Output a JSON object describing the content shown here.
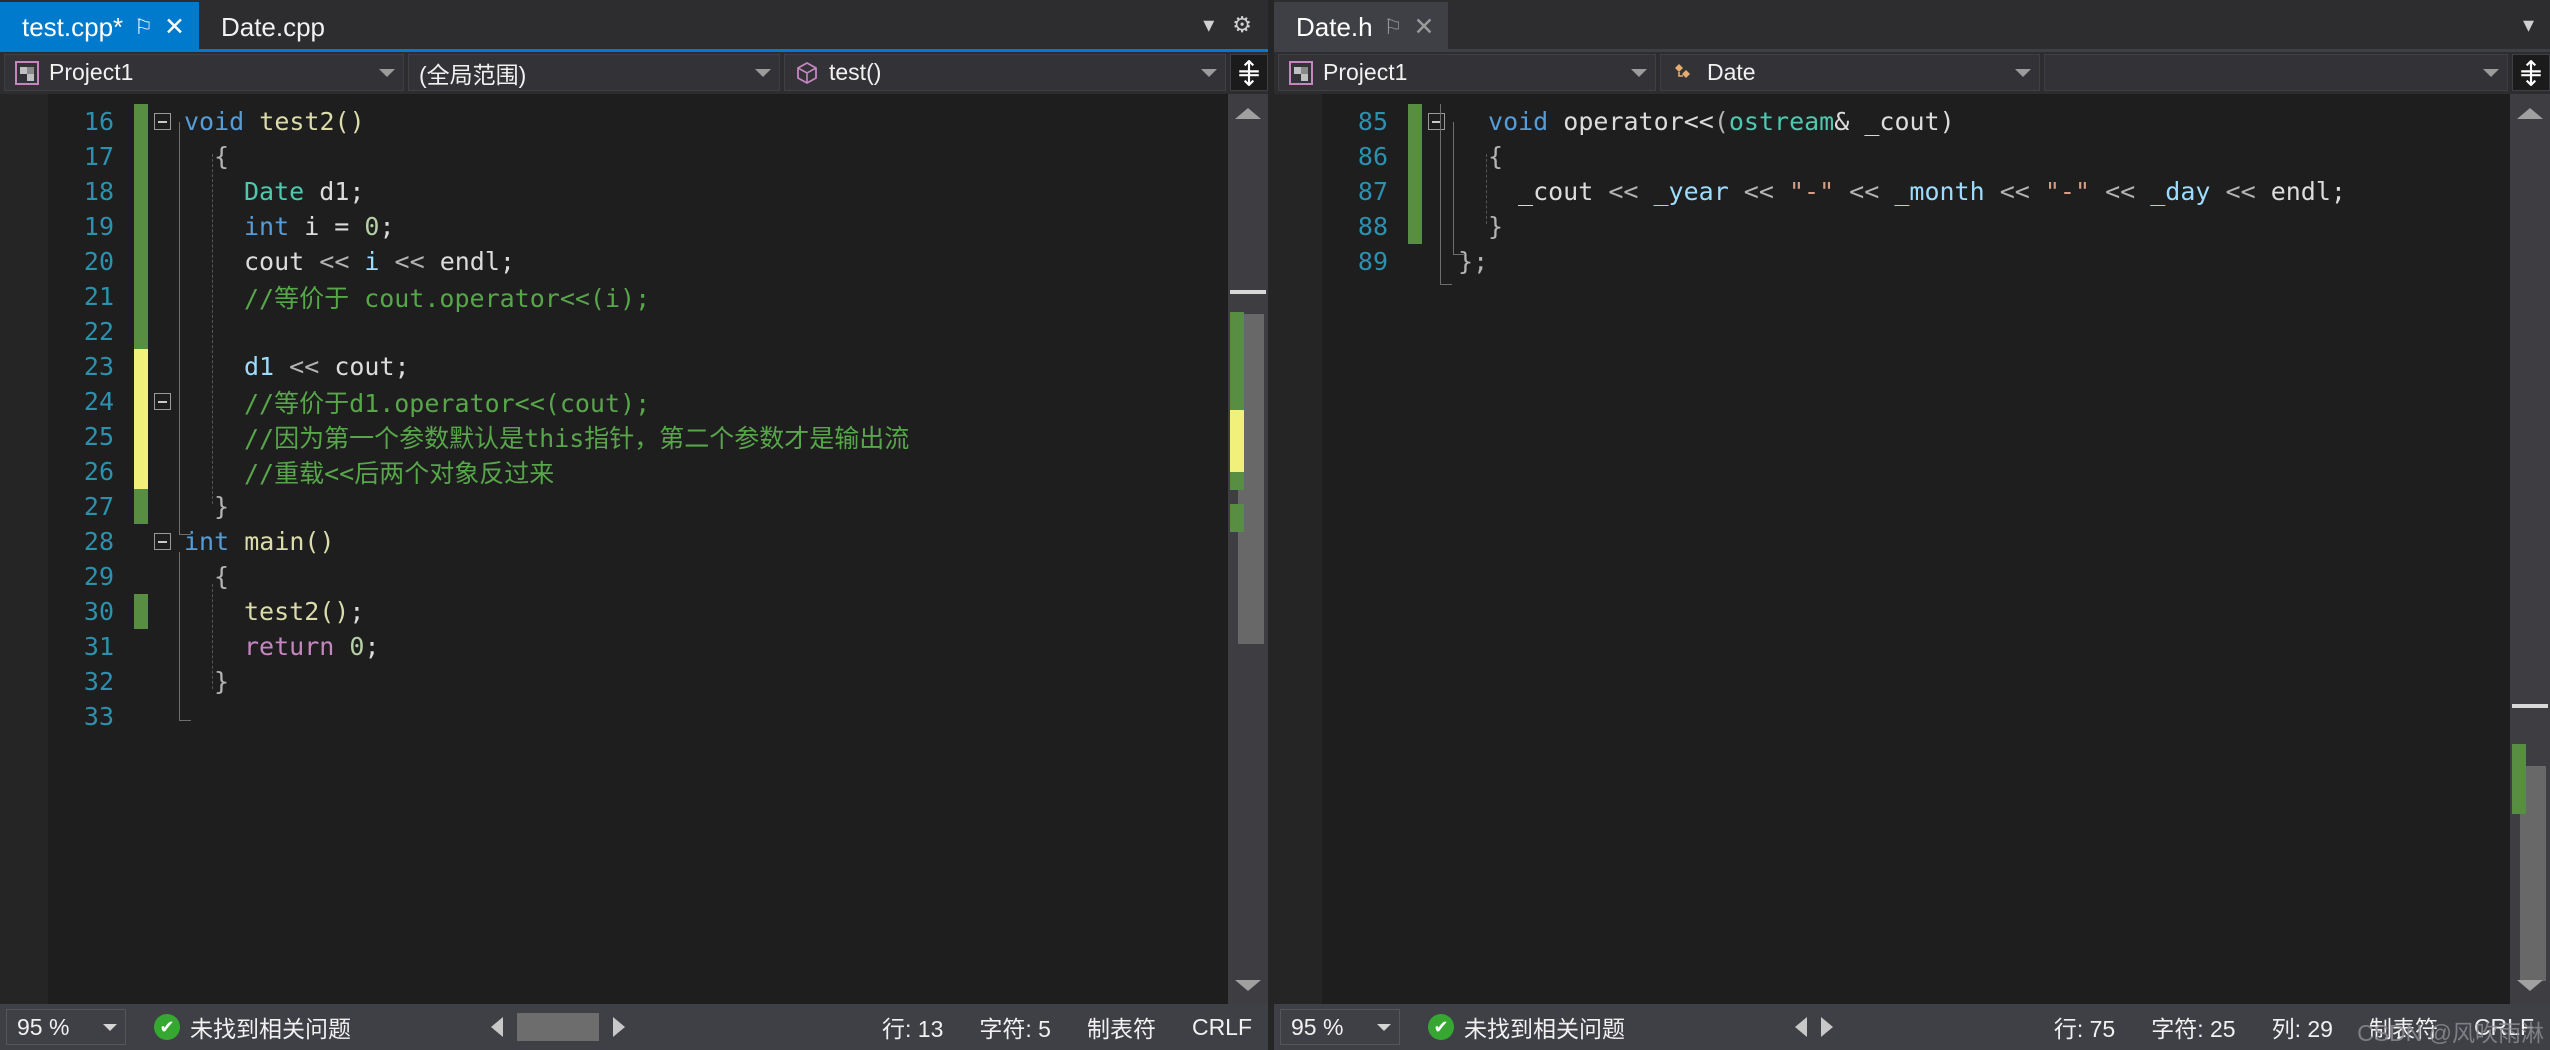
{
  "left_pane": {
    "tabs": [
      {
        "label": "test.cpp*",
        "state": "active",
        "pin": "⚐",
        "close": "✕"
      },
      {
        "label": "Date.cpp",
        "state": "inactive"
      }
    ],
    "tabstrip_buttons": {
      "dropdown": "▾",
      "settings": "⚙"
    },
    "navbar": {
      "project": "Project1",
      "scope": "(全局范围)",
      "member": "test()",
      "split_button": "⇕"
    },
    "code": {
      "lines": [
        {
          "n": "16",
          "change": "green",
          "fold": "minus",
          "indent": 0,
          "tokens": [
            {
              "t": "void ",
              "c": "t-key"
            },
            {
              "t": "test2()",
              "c": "t-fn"
            }
          ]
        },
        {
          "n": "17",
          "change": "green",
          "fold": "none",
          "indent": 1,
          "tokens": [
            {
              "t": "{",
              "c": "t-op"
            }
          ]
        },
        {
          "n": "18",
          "change": "green",
          "fold": "none",
          "indent": 2,
          "tokens": [
            {
              "t": "Date",
              "c": "t-type"
            },
            {
              "t": " d1;",
              "c": "t-plain"
            }
          ]
        },
        {
          "n": "19",
          "change": "green",
          "fold": "none",
          "indent": 2,
          "tokens": [
            {
              "t": "int",
              "c": "t-key"
            },
            {
              "t": " i = ",
              "c": "t-plain"
            },
            {
              "t": "0",
              "c": "t-num"
            },
            {
              "t": ";",
              "c": "t-plain"
            }
          ]
        },
        {
          "n": "20",
          "change": "green",
          "fold": "none",
          "indent": 2,
          "tokens": [
            {
              "t": "cout ",
              "c": "t-plain"
            },
            {
              "t": "<< ",
              "c": "t-op"
            },
            {
              "t": "i",
              "c": "t-var"
            },
            {
              "t": " << ",
              "c": "t-op"
            },
            {
              "t": "endl;",
              "c": "t-plain"
            }
          ]
        },
        {
          "n": "21",
          "change": "green",
          "fold": "none",
          "indent": 2,
          "tokens": [
            {
              "t": "//等价于 cout.operator<<(i);",
              "c": "t-cmt"
            }
          ]
        },
        {
          "n": "22",
          "change": "green",
          "fold": "none",
          "indent": 2,
          "tokens": []
        },
        {
          "n": "23",
          "change": "yellow",
          "fold": "none",
          "indent": 2,
          "tokens": [
            {
              "t": "d1",
              "c": "t-var"
            },
            {
              "t": " << ",
              "c": "t-op"
            },
            {
              "t": "cout;",
              "c": "t-plain"
            }
          ]
        },
        {
          "n": "24",
          "change": "yellow",
          "fold": "minus",
          "indent": 2,
          "tokens": [
            {
              "t": "//等价于d1.operator<<(cout);",
              "c": "t-cmt"
            }
          ]
        },
        {
          "n": "25",
          "change": "yellow",
          "fold": "none",
          "indent": 2,
          "tokens": [
            {
              "t": "//因为第一个参数默认是this指针，第二个参数才是输出流",
              "c": "t-cmt"
            }
          ]
        },
        {
          "n": "26",
          "change": "yellow",
          "fold": "none",
          "indent": 2,
          "tokens": [
            {
              "t": "//重载<<后两个对象反过来",
              "c": "t-cmt"
            }
          ]
        },
        {
          "n": "27",
          "change": "green",
          "fold": "none",
          "indent": 1,
          "tokens": [
            {
              "t": "}",
              "c": "t-op"
            }
          ]
        },
        {
          "n": "28",
          "change": "none",
          "fold": "minus",
          "indent": 0,
          "tokens": [
            {
              "t": "int",
              "c": "t-key"
            },
            {
              "t": " ",
              "c": "t-plain"
            },
            {
              "t": "main()",
              "c": "t-fn"
            }
          ]
        },
        {
          "n": "29",
          "change": "none",
          "fold": "none",
          "indent": 1,
          "tokens": [
            {
              "t": "{",
              "c": "t-op"
            }
          ]
        },
        {
          "n": "30",
          "change": "green",
          "fold": "none",
          "indent": 2,
          "tokens": [
            {
              "t": "test2()",
              "c": "t-fn"
            },
            {
              "t": ";",
              "c": "t-plain"
            }
          ]
        },
        {
          "n": "31",
          "change": "none",
          "fold": "none",
          "indent": 2,
          "tokens": [
            {
              "t": "return",
              "c": "t-kw2"
            },
            {
              "t": " ",
              "c": "t-plain"
            },
            {
              "t": "0",
              "c": "t-num"
            },
            {
              "t": ";",
              "c": "t-plain"
            }
          ]
        },
        {
          "n": "32",
          "change": "none",
          "fold": "none",
          "indent": 1,
          "tokens": [
            {
              "t": "}",
              "c": "t-op"
            }
          ]
        },
        {
          "n": "33",
          "change": "none",
          "fold": "none",
          "indent": 0,
          "tokens": []
        }
      ]
    },
    "statusbar": {
      "zoom": "95 %",
      "status_text": "未找到相关问题",
      "ok_glyph": "✔",
      "line_label": "行: 13",
      "char_label": "字符: 5",
      "col_label": "",
      "tabs_label": "制表符",
      "eol_label": "CRLF"
    }
  },
  "right_pane": {
    "tabs": [
      {
        "label": "Date.h",
        "state": "selected",
        "pin": "⚐",
        "close": "✕"
      }
    ],
    "tabstrip_buttons": {
      "dropdown": "▾"
    },
    "navbar": {
      "project": "Project1",
      "type": "Date",
      "member": "",
      "split_button": "⇕"
    },
    "code": {
      "lines": [
        {
          "n": "85",
          "change": "green",
          "fold": "minus",
          "indent": 1,
          "tokens": [
            {
              "t": "void",
              "c": "t-key"
            },
            {
              "t": " ",
              "c": "t-plain"
            },
            {
              "t": "operator<<",
              "c": "t-plain"
            },
            {
              "t": "(",
              "c": "t-op"
            },
            {
              "t": "ostream",
              "c": "t-type"
            },
            {
              "t": "& _cout)",
              "c": "t-plain"
            }
          ]
        },
        {
          "n": "86",
          "change": "green",
          "fold": "none",
          "indent": 1,
          "tokens": [
            {
              "t": "{",
              "c": "t-op"
            }
          ]
        },
        {
          "n": "87",
          "change": "green",
          "fold": "none",
          "indent": 2,
          "tokens": [
            {
              "t": "_cout ",
              "c": "t-plain"
            },
            {
              "t": "<< ",
              "c": "t-op"
            },
            {
              "t": "_year",
              "c": "t-var"
            },
            {
              "t": " << ",
              "c": "t-op"
            },
            {
              "t": "\"-\"",
              "c": "t-str"
            },
            {
              "t": " << ",
              "c": "t-op"
            },
            {
              "t": "_month",
              "c": "t-var"
            },
            {
              "t": " << ",
              "c": "t-op"
            },
            {
              "t": "\"-\"",
              "c": "t-str"
            },
            {
              "t": " << ",
              "c": "t-op"
            },
            {
              "t": "_day",
              "c": "t-var"
            },
            {
              "t": " << ",
              "c": "t-op"
            },
            {
              "t": "endl;",
              "c": "t-plain"
            }
          ]
        },
        {
          "n": "88",
          "change": "green",
          "fold": "none",
          "indent": 1,
          "tokens": [
            {
              "t": "}",
              "c": "t-op"
            }
          ]
        },
        {
          "n": "89",
          "change": "none",
          "fold": "none",
          "indent": 0,
          "tokens": [
            {
              "t": "};",
              "c": "t-op"
            }
          ]
        }
      ]
    },
    "statusbar": {
      "zoom": "95 %",
      "status_text": "未找到相关问题",
      "ok_glyph": "✔",
      "line_label": "行: 75",
      "char_label": "字符: 25",
      "col_label": "列: 29",
      "tabs_label": "制表符",
      "eol_label": "CRLF"
    }
  },
  "watermark": "CSDN @风吹雨淋",
  "theme": {
    "accent_blue": "#007acc",
    "editor_bg": "#1e1e1e",
    "chrome_bg": "#2d2d30",
    "statusbar_bg": "#3f3f46",
    "change_green": "#578e42",
    "change_yellow": "#f0f07a",
    "comment_green": "#57a64a",
    "keyword_blue": "#569cd6",
    "type_teal": "#4ec9b0",
    "string_orange": "#d69d85",
    "linenum_blue": "#2b91af"
  }
}
